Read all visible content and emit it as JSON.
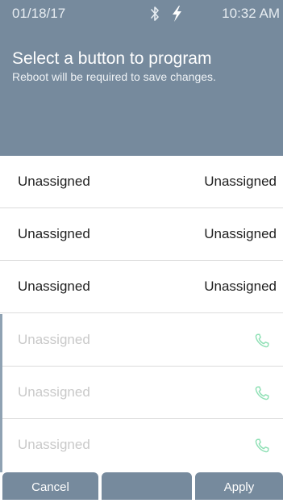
{
  "status": {
    "date": "01/18/17",
    "time": "10:32 AM",
    "icons": [
      "bluetooth-icon",
      "lightning-icon"
    ]
  },
  "header": {
    "title": "Select a button to program",
    "subtitle": "Reboot will be required to save changes."
  },
  "rows": [
    {
      "left": "Unassigned",
      "right": "Unassigned",
      "state": "active"
    },
    {
      "left": "Unassigned",
      "right": "Unassigned",
      "state": "active"
    },
    {
      "left": "Unassigned",
      "right": "Unassigned",
      "state": "active"
    },
    {
      "left": "Unassigned",
      "icon": "phone-icon",
      "state": "inactive"
    },
    {
      "left": "Unassigned",
      "icon": "phone-icon",
      "state": "inactive"
    },
    {
      "left": "Unassigned",
      "icon": "phone-icon",
      "state": "inactive"
    }
  ],
  "softkeys": {
    "cancel": "Cancel",
    "middle": "",
    "apply": "Apply"
  },
  "colors": {
    "header_bg": "#768a9d",
    "softkey_bg": "#768a9d",
    "phone_icon": "#8fe0b5",
    "inactive_text": "#c9c9c9"
  }
}
